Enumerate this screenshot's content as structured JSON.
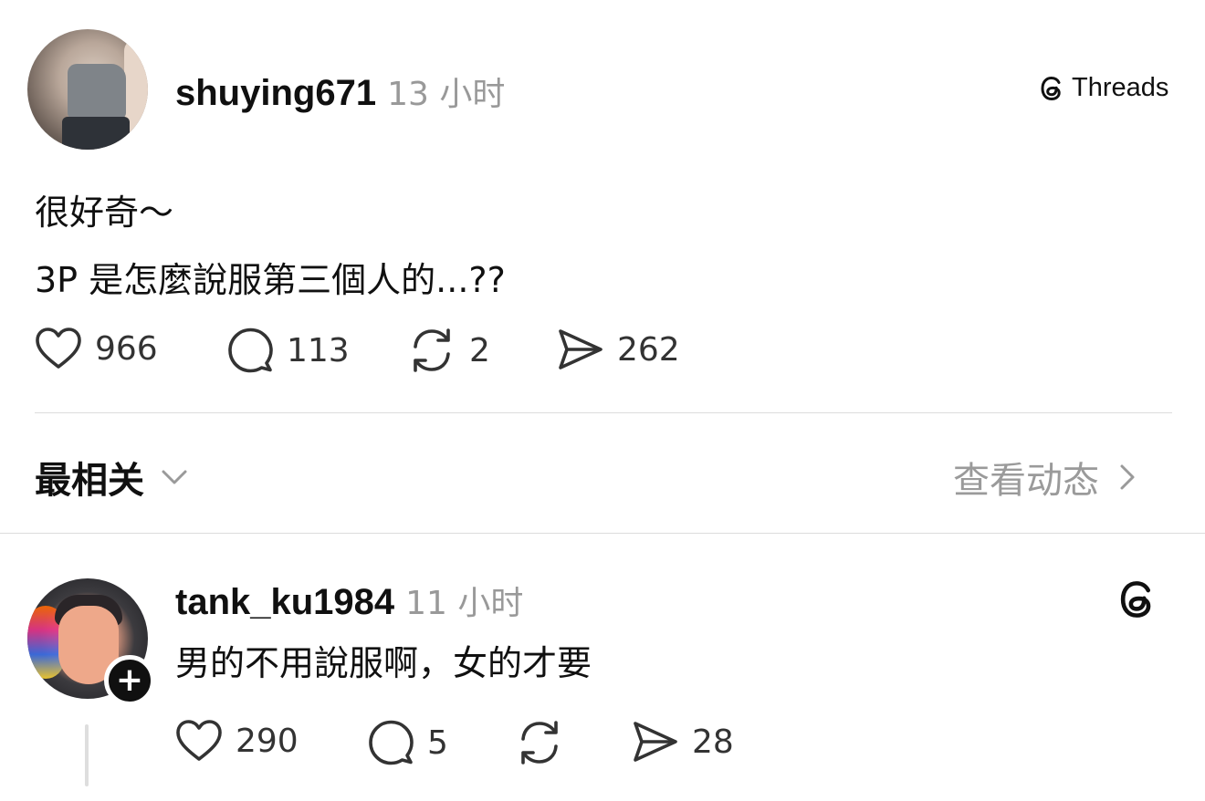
{
  "post": {
    "username": "shuying671",
    "time": "13 小时",
    "badge_label": "Threads",
    "text_lines": [
      "很好奇～",
      "3P 是怎麼說服第三個人的...??"
    ],
    "actions": {
      "likes": "966",
      "comments": "113",
      "reposts": "2",
      "shares": "262"
    }
  },
  "filter": {
    "sort_label": "最相关",
    "activity_label": "查看动态"
  },
  "reply": {
    "username": "tank_ku1984",
    "time": "11 小时",
    "text": "男的不用說服啊，女的才要",
    "actions": {
      "likes": "290",
      "comments": "5",
      "shares": "28"
    }
  },
  "icons": [
    "heart-icon",
    "comment-icon",
    "repost-icon",
    "share-icon",
    "threads-logo-icon",
    "chevron-down-icon",
    "chevron-right-icon",
    "plus-icon"
  ],
  "colors": {
    "text": "#101010",
    "muted": "#999999",
    "divider": "#dcdcdc"
  }
}
